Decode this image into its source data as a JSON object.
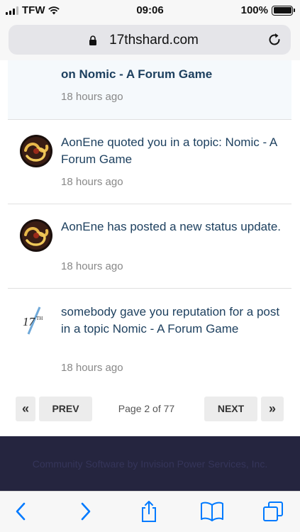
{
  "status_bar": {
    "carrier": "TFW",
    "time": "09:06",
    "battery": "100%"
  },
  "address_bar": {
    "url": "17thshard.com"
  },
  "notifications": [
    {
      "title": "on Nomic - A Forum Game",
      "time": "18 hours ago"
    },
    {
      "title": "AonEne quoted you in a topic: Nomic - A Forum Game",
      "time": "18 hours ago"
    },
    {
      "title": "AonEne has posted a new status update.",
      "time": "18 hours ago"
    },
    {
      "title": "somebody gave you reputation for a post in a topic Nomic - A Forum Game",
      "time": "18 hours ago",
      "avatar_text": "17",
      "avatar_sup": "TH"
    }
  ],
  "pagination": {
    "first": "«",
    "prev": "PREV",
    "page_label": "Page 2 of 77",
    "next": "NEXT",
    "last": "»"
  },
  "footer": {
    "text": "Community Software by Invision Power Services, Inc."
  },
  "colors": {
    "accent": "#1c3f5e",
    "footer_bg": "#25253f",
    "ios_blue": "#007aff"
  }
}
